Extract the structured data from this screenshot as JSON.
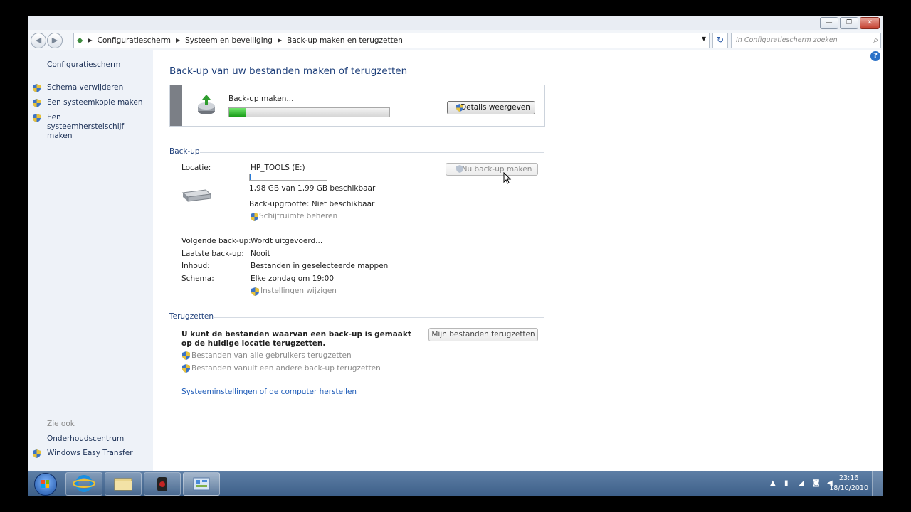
{
  "window": {
    "minimize": "—",
    "maximize": "❐",
    "close": "✕"
  },
  "address": {
    "crumbs": [
      "Configuratiescherm",
      "Systeem en beveiliging",
      "Back-up maken en terugzetten"
    ],
    "search_placeholder": "In Configuratiescherm zoeken"
  },
  "sidebar": {
    "home": "Configuratiescherm",
    "tasks": [
      "Schema verwijderen",
      "Een systeemkopie maken",
      "Een systeemherstelschijf maken"
    ],
    "see_also_title": "Zie ook",
    "see_also": [
      "Onderhoudscentrum",
      "Windows Easy Transfer"
    ]
  },
  "main": {
    "title": "Back-up van uw bestanden maken of terugzetten",
    "banner": {
      "status": "Back-up maken...",
      "progress": 0.1,
      "details_button": "Details weergeven"
    },
    "backup": {
      "heading": "Back-up",
      "location_label": "Locatie:",
      "location_value": "HP_TOOLS (E:)",
      "drive_usage_fraction": 0.01,
      "space": "1,98 GB van 1,99 GB beschikbaar",
      "size": "Back-upgrootte: Niet beschikbaar",
      "manage_space": "Schijfruimte beheren",
      "backup_now": "Nu back-up maken",
      "next_label": "Volgende back-up:",
      "next_value": "Wordt uitgevoerd...",
      "last_label": "Laatste back-up:",
      "last_value": "Nooit",
      "contents_label": "Inhoud:",
      "contents_value": "Bestanden in geselecteerde mappen",
      "schedule_label": "Schema:",
      "schedule_value": "Elke zondag om 19:00",
      "change_settings": "Instellingen wijzigen"
    },
    "restore": {
      "heading": "Terugzetten",
      "description": "U kunt de bestanden waarvan een back-up is gemaakt op de huidige locatie terugzetten.",
      "restore_button": "Mijn bestanden terugzetten",
      "all_users": "Bestanden van alle gebruikers terugzetten",
      "other_backup": "Bestanden vanuit een andere back-up terugzetten",
      "system_settings": "Systeeminstellingen of de computer herstellen"
    }
  },
  "taskbar": {
    "time": "23:16",
    "date": "18/10/2010"
  },
  "colors": {
    "progress": "#1a9d1a",
    "link": "#1d5bb8",
    "title": "#1e3f7a"
  }
}
